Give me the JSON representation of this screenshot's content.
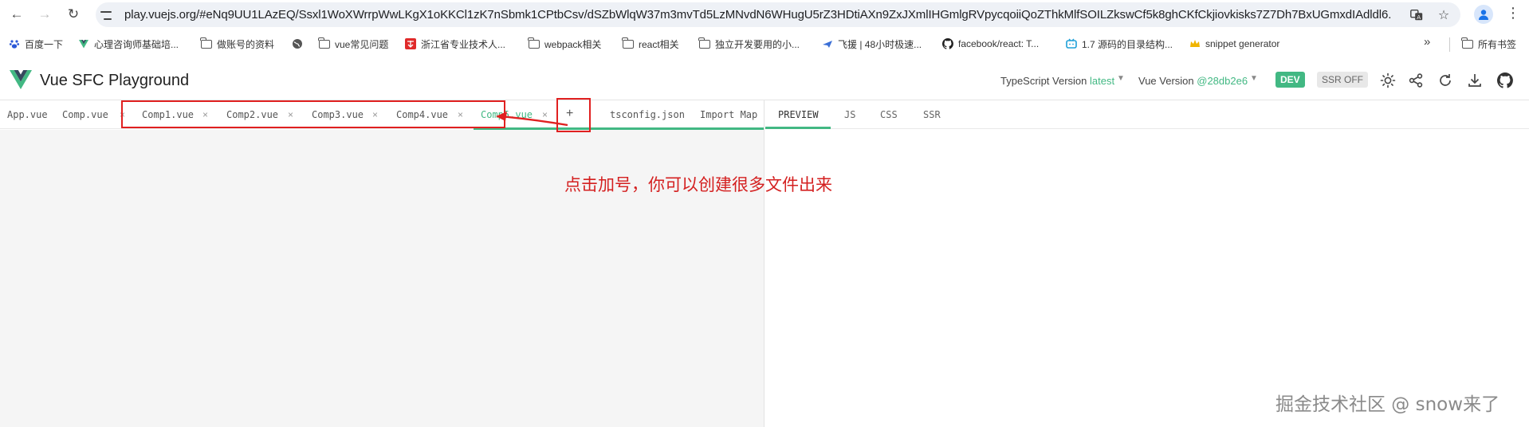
{
  "browser": {
    "url": "play.vuejs.org/#eNq9UU1LAzEQ/Ssxl1WoXWrrpWwLKgX1oKKCl1zK7nSbmk1CPtbCsv/dSZbWlqW37m3mvTd5LzMNvdN6WHugU5rZ3HDtiAXn9ZxJXmlIHGmlgRVpycqoiiQoZThkMlfSOILZkswCf5k8ghCKfCkjiovkisks7Z7Dh7BxUGmxdIAdldl6...",
    "bookmarks": [
      {
        "label": "百度一下",
        "icon": "paw-icon"
      },
      {
        "label": "心理咨询师基础培...",
        "icon": "vue-logo-icon"
      },
      {
        "label": "做账号的资料",
        "icon": "folder-icon"
      },
      {
        "label": "",
        "icon": "globe-icon"
      },
      {
        "label": "vue常见问题",
        "icon": "folder-icon"
      },
      {
        "label": "浙江省专业技术人...",
        "icon": "red-badge-icon"
      },
      {
        "label": "webpack相关",
        "icon": "folder-icon"
      },
      {
        "label": "react相关",
        "icon": "folder-icon"
      },
      {
        "label": "独立开发要用的小...",
        "icon": "folder-icon"
      },
      {
        "label": "飞援 | 48小时极速...",
        "icon": "plane-icon"
      },
      {
        "label": "facebook/react: T...",
        "icon": "github-icon"
      },
      {
        "label": "1.7 源码的目录结构...",
        "icon": "tv-icon"
      },
      {
        "label": "snippet generator",
        "icon": "crown-icon"
      }
    ],
    "all_bookmarks": "所有书签",
    "more": "»"
  },
  "app": {
    "title": "Vue SFC Playground",
    "ts_label": "TypeScript Version",
    "ts_value": "latest",
    "vue_label": "Vue Version",
    "vue_value": "@28db2e6",
    "dev_badge": "DEV",
    "ssr_badge": "SSR OFF",
    "accent": "#42b883"
  },
  "file_tabs": [
    {
      "name": "App.vue",
      "closable": false
    },
    {
      "name": "Comp.vue",
      "closable": true
    },
    {
      "name": "Comp1.vue",
      "closable": true
    },
    {
      "name": "Comp2.vue",
      "closable": true
    },
    {
      "name": "Comp3.vue",
      "closable": true
    },
    {
      "name": "Comp4.vue",
      "closable": true
    },
    {
      "name": "Comp5.vue",
      "closable": true,
      "active": true
    }
  ],
  "add_file": "+",
  "extra_tabs": [
    "tsconfig.json",
    "Import Map"
  ],
  "output_tabs": [
    {
      "name": "PREVIEW",
      "active": true
    },
    {
      "name": "JS"
    },
    {
      "name": "CSS"
    },
    {
      "name": "SSR"
    }
  ],
  "close_glyph": "×",
  "annotation": {
    "text": "点击加号，你可以创建很多文件出来",
    "color": "#e02020"
  },
  "watermark": "掘金技术社区 @ snow来了"
}
